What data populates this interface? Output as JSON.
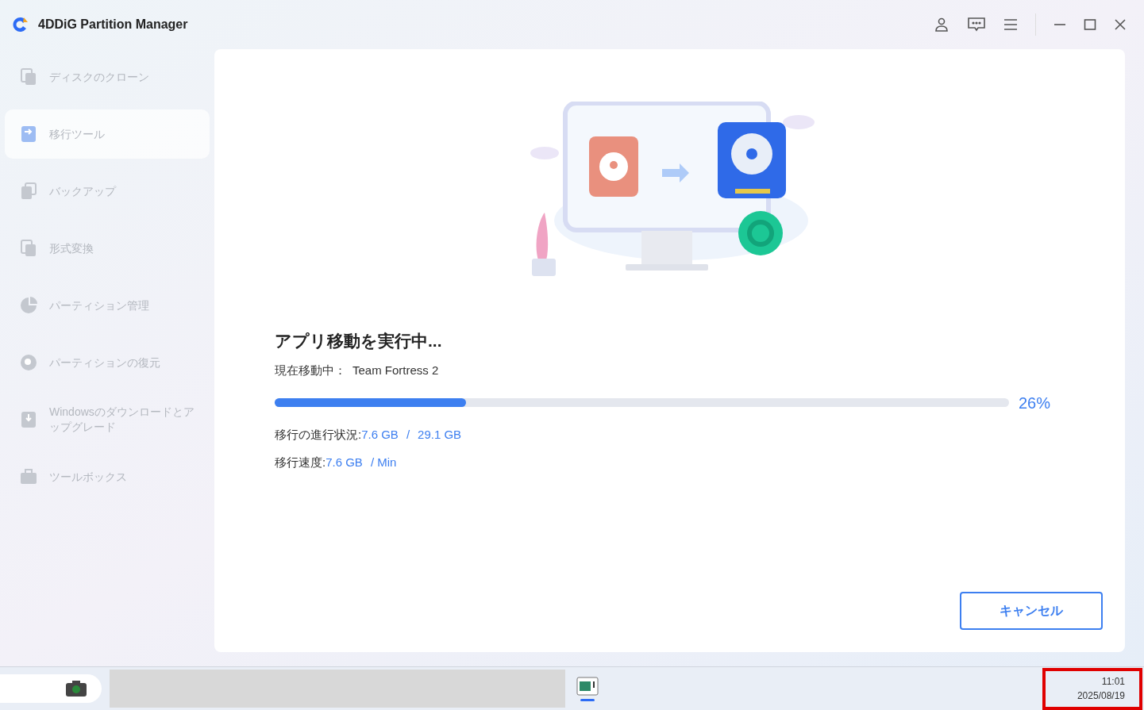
{
  "app": {
    "title": "4DDiG Partition Manager"
  },
  "sidebar": {
    "items": [
      {
        "label": "ディスクのクローン",
        "selected": false,
        "disabled": true
      },
      {
        "label": "移行ツール",
        "selected": true,
        "disabled": true
      },
      {
        "label": "バックアップ",
        "selected": false,
        "disabled": true
      },
      {
        "label": "形式変換",
        "selected": false,
        "disabled": true
      },
      {
        "label": "パーティション管理",
        "selected": false,
        "disabled": true
      },
      {
        "label": "パーティションの復元",
        "selected": false,
        "disabled": true
      },
      {
        "label": "Windowsのダウンロードとアップグレード",
        "selected": false,
        "disabled": true
      },
      {
        "label": "ツールボックス",
        "selected": false,
        "disabled": true
      }
    ]
  },
  "progress": {
    "title": "アプリ移動を実行中...",
    "current_label": "現在移動中：",
    "current_value": "Team Fortress 2",
    "level": 0.26,
    "percent": "26%",
    "status_label": "移行の進行状況:",
    "status_done": "7.6 GB",
    "status_sep": "/",
    "status_total": "29.1 GB",
    "speed_label": "移行速度:",
    "speed_value": "7.6 GB",
    "speed_unit": "/ Min"
  },
  "cancel_button": "キャンセル",
  "taskbar": {
    "time": "11:01",
    "date": "2025/08/19"
  }
}
